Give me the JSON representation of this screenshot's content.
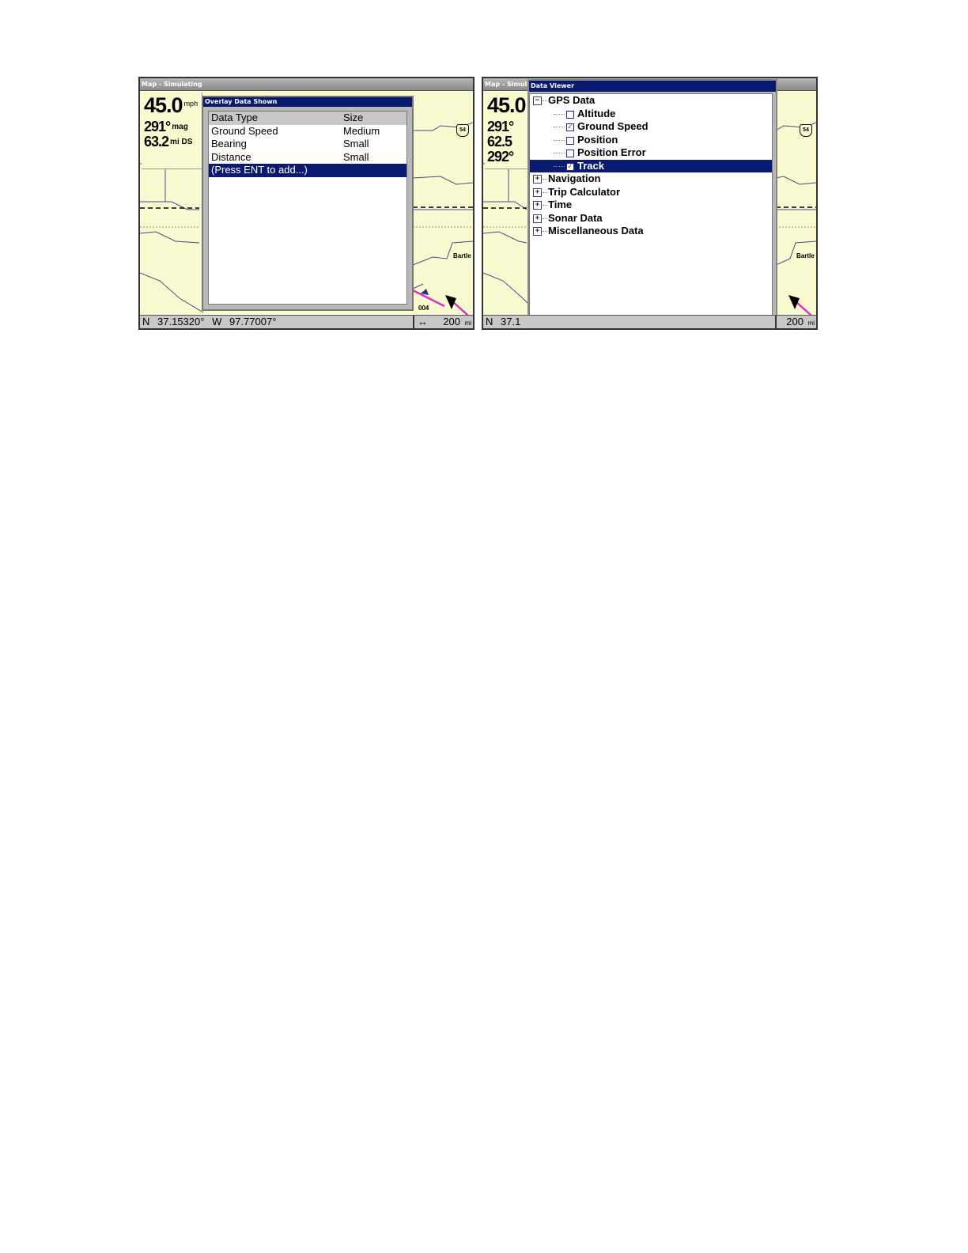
{
  "left_screen": {
    "title": "Map - Simulating",
    "data_box": {
      "speed_value": "45.0",
      "speed_unit": "mph",
      "bearing_value": "291°",
      "bearing_unit": "mag",
      "distance_value": "63.2",
      "distance_unit": "mi DS"
    },
    "dialog": {
      "title": "Overlay Data Shown",
      "header": {
        "col1": "Data Type",
        "col2": "Size"
      },
      "rows": [
        {
          "type": "Ground Speed",
          "size": "Medium"
        },
        {
          "type": "Bearing",
          "size": "Small"
        },
        {
          "type": "Distance",
          "size": "Small"
        }
      ],
      "add_prompt": "(Press ENT to add...)"
    },
    "status": {
      "lat_dir": "N",
      "lat": "37.15320°",
      "lon_dir": "W",
      "lon": "97.77007°",
      "scale_value": "200",
      "scale_unit": "mi",
      "scale_arrow": "↔"
    },
    "map_labels": {
      "highway": "54",
      "town": "Bartle",
      "route": "004"
    }
  },
  "right_screen": {
    "title": "Map - Simulating",
    "data_box": {
      "speed_value": "45.0",
      "bearing_value": "291°",
      "distance_value": "62.5",
      "bearing2_value": "292°"
    },
    "dialog": {
      "title": "Data Viewer",
      "tree": [
        {
          "label": "GPS Data",
          "kind": "group",
          "expanded": true
        },
        {
          "label": "Altitude",
          "kind": "item",
          "checked": false
        },
        {
          "label": "Ground Speed",
          "kind": "item",
          "checked": true
        },
        {
          "label": "Position",
          "kind": "item",
          "checked": false
        },
        {
          "label": "Position Error",
          "kind": "item",
          "checked": false
        },
        {
          "label": "Track",
          "kind": "item",
          "checked": true,
          "selected": true
        },
        {
          "label": "Navigation",
          "kind": "group",
          "expanded": false
        },
        {
          "label": "Trip Calculator",
          "kind": "group",
          "expanded": false
        },
        {
          "label": "Time",
          "kind": "group",
          "expanded": false
        },
        {
          "label": "Sonar Data",
          "kind": "group",
          "expanded": false
        },
        {
          "label": "Miscellaneous Data",
          "kind": "group",
          "expanded": false
        }
      ]
    },
    "status": {
      "lat_dir": "N",
      "lat": "37.1",
      "scale_value": "200",
      "scale_unit": "mi"
    },
    "map_labels": {
      "highway": "54",
      "town": "Bartle"
    }
  },
  "colors": {
    "map_background": "#fafad0",
    "dialog_titlebar": "#0a1a6e",
    "selection": "#0a1a6e",
    "route_line": "#e030c0",
    "check_mark": "#c01010"
  }
}
